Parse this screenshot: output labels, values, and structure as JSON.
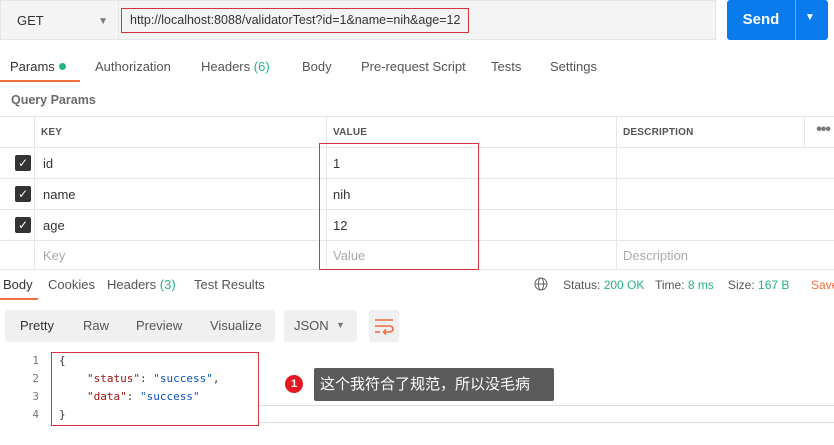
{
  "request": {
    "method": "GET",
    "url": "http://localhost:8088/validatorTest?id=1&name=nih&age=12",
    "send_label": "Send"
  },
  "tabs": {
    "params": "Params",
    "authorization": "Authorization",
    "headers": "Headers",
    "headers_count": "(6)",
    "body": "Body",
    "prerequest": "Pre-request Script",
    "tests": "Tests",
    "settings": "Settings"
  },
  "query_params": {
    "title": "Query Params",
    "columns": {
      "key": "KEY",
      "value": "VALUE",
      "description": "DESCRIPTION"
    },
    "rows": [
      {
        "key": "id",
        "value": "1",
        "checked": true
      },
      {
        "key": "name",
        "value": "nih",
        "checked": true
      },
      {
        "key": "age",
        "value": "12",
        "checked": true
      }
    ],
    "placeholder": {
      "key": "Key",
      "value": "Value",
      "description": "Description"
    }
  },
  "response": {
    "tabs": {
      "body": "Body",
      "cookies": "Cookies",
      "headers": "Headers",
      "headers_count": "(3)",
      "test_results": "Test Results"
    },
    "status_label": "Status:",
    "status_value": "200 OK",
    "time_label": "Time:",
    "time_value": "8 ms",
    "size_label": "Size:",
    "size_value": "167 B",
    "save_label": "Save",
    "view_buttons": {
      "pretty": "Pretty",
      "raw": "Raw",
      "preview": "Preview",
      "visualize": "Visualize"
    },
    "format": "JSON",
    "code": {
      "line_numbers": [
        "1",
        "2",
        "3",
        "4"
      ],
      "open_brace": "{",
      "status_key": "\"status\"",
      "status_val": "\"success\"",
      "data_key": "\"data\"",
      "data_val": "\"success\"",
      "close_brace": "}"
    }
  },
  "annotation": {
    "badge": "1",
    "text": "这个我符合了规范，所以没毛病"
  },
  "colors": {
    "accent": "#f26b3a",
    "send": "#097bed",
    "highlight_border": "#d9333f",
    "success": "#26b47f"
  }
}
